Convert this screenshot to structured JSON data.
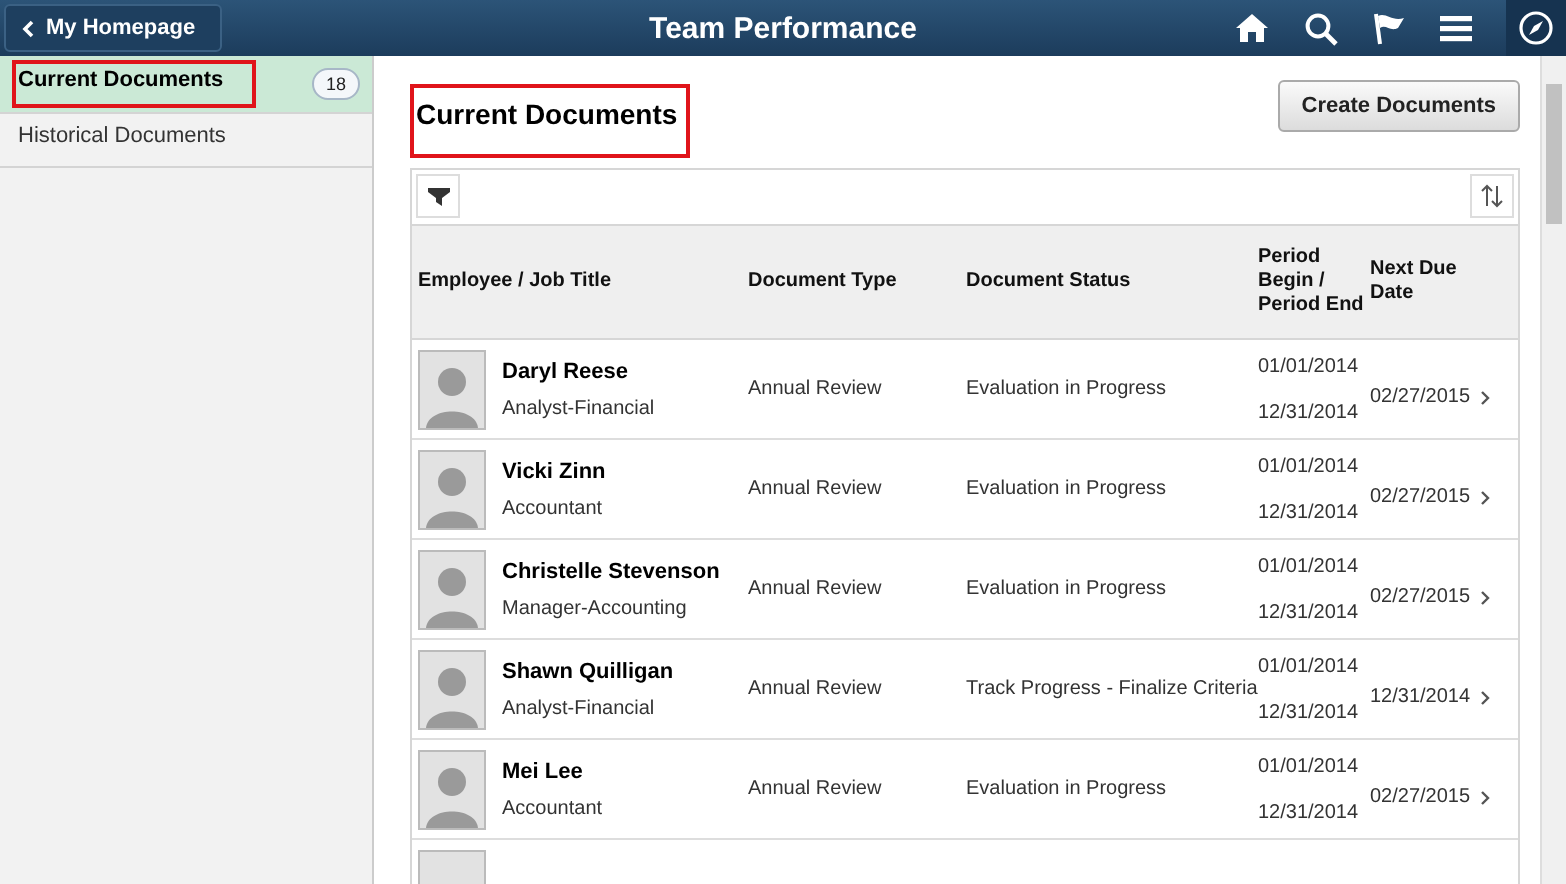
{
  "header": {
    "back_label": "My Homepage",
    "title": "Team Performance"
  },
  "sidebar": {
    "items": [
      {
        "label": "Current Documents",
        "count": "18",
        "selected": true,
        "highlighted": true
      },
      {
        "label": "Historical Documents",
        "selected": false,
        "highlighted": false
      }
    ]
  },
  "page": {
    "title": "Current Documents",
    "title_highlighted": true,
    "create_button": "Create Documents"
  },
  "table": {
    "columns": [
      "Employee / Job Title",
      "Document Type",
      "Document Status",
      "Period Begin / Period End",
      "Next Due Date"
    ],
    "rows": [
      {
        "name": "Daryl Reese",
        "job": "Analyst-Financial",
        "type": "Annual Review",
        "status": "Evaluation in Progress",
        "begin": "01/01/2014",
        "end": "12/31/2014",
        "due": "02/27/2015"
      },
      {
        "name": "Vicki Zinn",
        "job": "Accountant",
        "type": "Annual Review",
        "status": "Evaluation in Progress",
        "begin": "01/01/2014",
        "end": "12/31/2014",
        "due": "02/27/2015"
      },
      {
        "name": "Christelle Stevenson",
        "job": "Manager-Accounting",
        "type": "Annual Review",
        "status": "Evaluation in Progress",
        "begin": "01/01/2014",
        "end": "12/31/2014",
        "due": "02/27/2015"
      },
      {
        "name": "Shawn Quilligan",
        "job": "Analyst-Financial",
        "type": "Annual Review",
        "status": "Track Progress - Finalize Criteria",
        "begin": "01/01/2014",
        "end": "12/31/2014",
        "due": "12/31/2014"
      },
      {
        "name": "Mei Lee",
        "job": "Accountant",
        "type": "Annual Review",
        "status": "Evaluation in Progress",
        "begin": "01/01/2014",
        "end": "12/31/2014",
        "due": "02/27/2015"
      }
    ]
  }
}
